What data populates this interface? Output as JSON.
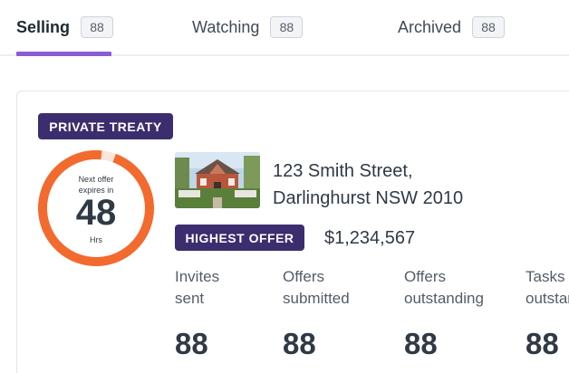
{
  "tabs": [
    {
      "label": "Selling",
      "count": "88",
      "active": true
    },
    {
      "label": "Watching",
      "count": "88",
      "active": false
    },
    {
      "label": "Archived",
      "count": "88",
      "active": false
    }
  ],
  "listing": {
    "sale_type": "PRIVATE TREATY",
    "countdown": {
      "caption_line1": "Next offer",
      "caption_line2": "expires in",
      "value": "48",
      "unit": "Hrs",
      "progress_fraction": 0.96
    },
    "address_line1": "123 Smith Street,",
    "address_line2": "Darlinghurst NSW 2010",
    "highest_offer_label": "HIGHEST OFFER",
    "highest_offer_amount": "$1,234,567",
    "stats": [
      {
        "label_line1": "Invites",
        "label_line2": "sent",
        "value": "88"
      },
      {
        "label_line1": "Offers",
        "label_line2": "submitted",
        "value": "88"
      },
      {
        "label_line1": "Offers",
        "label_line2": "outstanding",
        "value": "88"
      },
      {
        "label_line1": "Tasks",
        "label_line2": "outstanding",
        "value": "88"
      }
    ]
  },
  "colors": {
    "accent_underline": "#8a5cd6",
    "pill_bg": "#3c2d6e",
    "countdown_ring": "#f26a2e",
    "countdown_track": "#fde5da"
  }
}
